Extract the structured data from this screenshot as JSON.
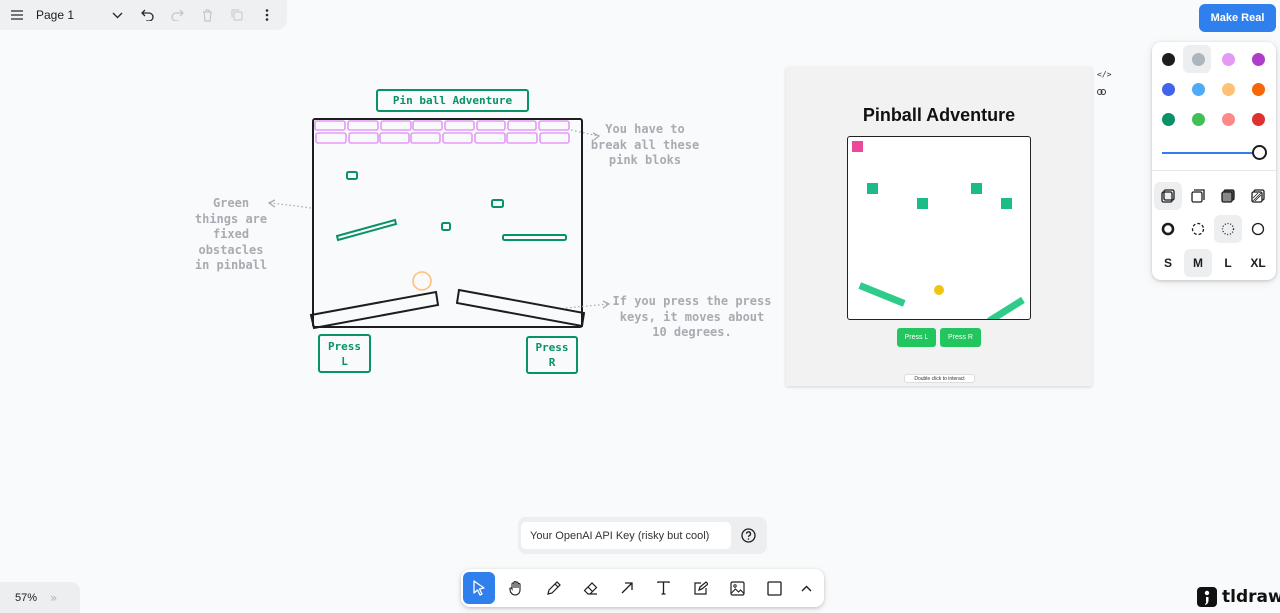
{
  "topbar": {
    "page_name": "Page 1",
    "icons": [
      "menu-icon",
      "chevron-down-icon",
      "undo-icon",
      "redo-icon",
      "trash-icon",
      "duplicate-icon",
      "more-icon"
    ]
  },
  "make_real": {
    "label": "Make Real"
  },
  "style_panel": {
    "colors": [
      "#1d1d1d",
      "#adb5bd",
      "#e599f7",
      "#ae3ec9",
      "#4263eb",
      "#4dabf7",
      "#ffc078",
      "#f76707",
      "#099268",
      "#40c057",
      "#ff8787",
      "#e03131"
    ],
    "selected_color": "#adb5bd",
    "sizes": [
      "S",
      "M",
      "L",
      "XL"
    ],
    "selected_size": "M"
  },
  "sketch": {
    "title": "Pin ball Adventure",
    "note_green": "Green\nthings are\nfixed\nobstacles\nin pinball",
    "note_pink": "You have to\nbreak all these\npink bloks",
    "note_keys": "If you press the press\nkeys, it moves about\n10 degrees.",
    "press_left": "Press\nL",
    "press_right": "Press\nR"
  },
  "preview": {
    "title": "Pinball Adventure",
    "press_left": "Press L",
    "press_right": "Press R",
    "hint": "Double click to interact",
    "colors": {
      "pink": "#ec4899",
      "green": "#1abc8a",
      "ball": "#f1c40f",
      "button": "#22c55e"
    }
  },
  "api": {
    "placeholder": "Your OpenAI API Key (risky but cool)"
  },
  "toolbar": {
    "tools": [
      "select-tool",
      "hand-tool",
      "draw-tool",
      "eraser-tool",
      "arrow-tool",
      "text-tool",
      "note-tool",
      "media-tool",
      "rectangle-tool",
      "more-tools"
    ],
    "active": "select-tool"
  },
  "zoom": {
    "value": "57%"
  },
  "brand": {
    "name": "tldraw"
  }
}
